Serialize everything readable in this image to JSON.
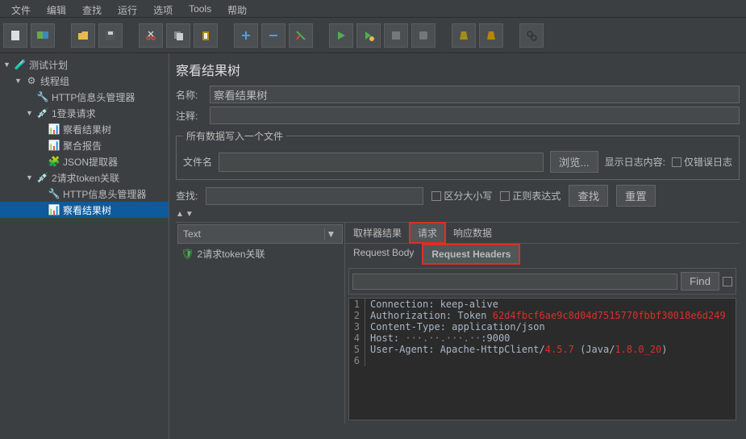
{
  "menu": [
    "文件",
    "编辑",
    "查找",
    "运行",
    "选项",
    "Tools",
    "帮助"
  ],
  "tree": {
    "testplan": "测试计划",
    "threadgroup": "线程组",
    "httpheader1": "HTTP信息头管理器",
    "login": "1登录请求",
    "viewtree1": "察看结果树",
    "aggreport": "聚合报告",
    "jsonextract": "JSON提取器",
    "tokenreq": "2请求token关联",
    "httpheader2": "HTTP信息头管理器",
    "viewtree2": "察看结果树"
  },
  "panel": {
    "title": "察看结果树",
    "name_label": "名称:",
    "name_value": "察看结果树",
    "comment_label": "注释:",
    "fieldset_legend": "所有数据写入一个文件",
    "filename_label": "文件名",
    "browse": "浏览...",
    "showlog": "显示日志内容:",
    "errorsonly": "仅错误日志",
    "search_label": "查找:",
    "casesens": "区分大小写",
    "regex": "正则表达式",
    "search_btn": "查找",
    "reset_btn": "重置"
  },
  "dropdown": "Text",
  "sample": "2请求token关联",
  "tabs": {
    "sampler": "取样器结果",
    "request": "请求",
    "response": "响应数据"
  },
  "subtabs": {
    "body": "Request Body",
    "headers": "Request Headers"
  },
  "find_btn": "Find",
  "headers": [
    {
      "n": "1",
      "pre": "Connection: keep-alive",
      "red": ""
    },
    {
      "n": "2",
      "pre": "Authorization: Token ",
      "red": "62d4fbcf6ae9c8d04d7515770fbbf30018e6d249"
    },
    {
      "n": "3",
      "pre": "Content-Type: application/json",
      "red": ""
    },
    {
      "n": "4",
      "pre": "Host: ",
      "mid_gray": "···.··.···.··",
      "post": ":9000",
      "red": ""
    },
    {
      "n": "5",
      "pre": "User-Agent: Apache-HttpClient/",
      "v1": "4.5.7",
      "mid": " (Java/",
      "v2": "1.8.0_20",
      "end": ")"
    },
    {
      "n": "6",
      "pre": "",
      "red": ""
    }
  ]
}
